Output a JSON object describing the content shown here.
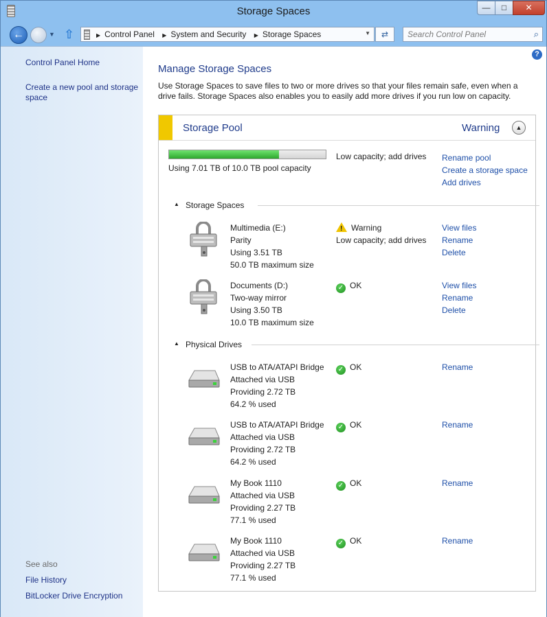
{
  "window": {
    "title": "Storage Spaces",
    "min": "—",
    "max": "□",
    "close": "✕"
  },
  "nav": {
    "back_icon": "←",
    "forward_icon": "→",
    "dropdown_icon": "▼",
    "up_icon": "⇧",
    "breadcrumb": [
      "Control Panel",
      "System and Security",
      "Storage Spaces"
    ],
    "breadcrumb_sep": "▶",
    "address_dropdown_icon": "▼",
    "refresh_icon": "⇄",
    "search_placeholder": "Search Control Panel",
    "search_icon": "⌕"
  },
  "sidebar": {
    "home": "Control Panel Home",
    "create_pool": "Create a new pool and storage space",
    "see_also": "See also",
    "links": [
      "File History",
      "BitLocker Drive Encryption"
    ]
  },
  "main": {
    "help_icon": "?",
    "title": "Manage Storage Spaces",
    "intro": "Use Storage Spaces to save files to two or more drives so that your files remain safe, even when a drive fails. Storage Spaces also enables you to easily add more drives if you run low on capacity.",
    "pool": {
      "title": "Storage Pool",
      "status": "Warning",
      "collapse_icon": "▲",
      "capacity_used_fraction": 0.701,
      "capacity_text": "Using 7.01 TB of 10.0 TB pool capacity",
      "capacity_status": "Low capacity; add drives",
      "links": [
        "Rename pool",
        "Create a storage space",
        "Add drives"
      ],
      "accent": "#f0c800"
    },
    "spaces": {
      "section_title": "Storage Spaces",
      "section_icon": "▲",
      "items": [
        {
          "name": "Multimedia (E:)",
          "type": "Parity",
          "using": "Using 3.51 TB",
          "max": "50.0 TB maximum size",
          "status": "Warning",
          "status_detail": "Low capacity; add drives",
          "status_icon": "warning-icon",
          "actions": [
            "View files",
            "Rename",
            "Delete"
          ]
        },
        {
          "name": "Documents (D:)",
          "type": "Two-way mirror",
          "using": "Using 3.50 TB",
          "max": "10.0 TB maximum size",
          "status": "OK",
          "status_detail": "",
          "status_icon": "ok-icon",
          "actions": [
            "View files",
            "Rename",
            "Delete"
          ]
        }
      ]
    },
    "drives": {
      "section_title": "Physical Drives",
      "section_icon": "▲",
      "ok_glyph": "✓",
      "items": [
        {
          "name": "USB to ATA/ATAPI Bridge",
          "conn": "Attached via USB",
          "prov": "Providing 2.72 TB",
          "used": "64.2 % used",
          "status": "OK",
          "action": "Rename"
        },
        {
          "name": "USB to ATA/ATAPI Bridge",
          "conn": "Attached via USB",
          "prov": "Providing 2.72 TB",
          "used": "64.2 % used",
          "status": "OK",
          "action": "Rename"
        },
        {
          "name": "My Book 1110",
          "conn": "Attached via USB",
          "prov": "Providing 2.27 TB",
          "used": "77.1 % used",
          "status": "OK",
          "action": "Rename"
        },
        {
          "name": "My Book 1110",
          "conn": "Attached via USB",
          "prov": "Providing 2.27 TB",
          "used": "77.1 % used",
          "status": "OK",
          "action": "Rename"
        }
      ]
    }
  }
}
